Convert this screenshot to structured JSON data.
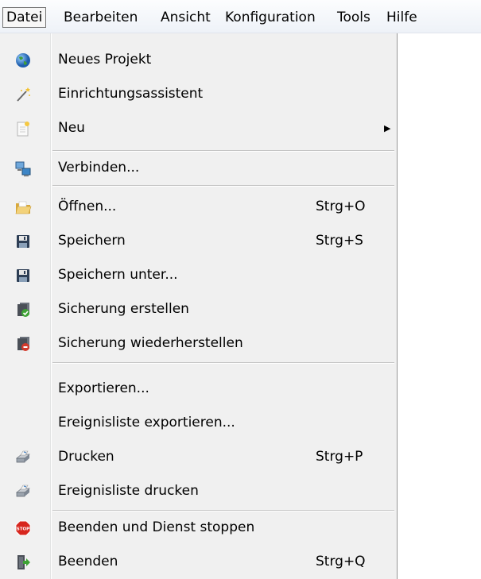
{
  "menubar": {
    "items": [
      {
        "label": "Datei",
        "active": true
      },
      {
        "label": "Bearbeiten"
      },
      {
        "label": "Ansicht"
      },
      {
        "label": "Konfiguration"
      },
      {
        "label": "Tools"
      },
      {
        "label": "Hilfe"
      }
    ]
  },
  "menu": {
    "items": [
      {
        "label": "Neues Projekt",
        "icon": "globe-icon"
      },
      {
        "label": "Einrichtungsassistent",
        "icon": "magic-wand-icon"
      },
      {
        "label": "Neu",
        "icon": "new-document-icon",
        "submenu_arrow": "▶"
      },
      {
        "label": "Verbinden...",
        "icon": "network-connect-icon"
      },
      {
        "label": "Öffnen...",
        "icon": "open-folder-icon",
        "shortcut": "Strg+O"
      },
      {
        "label": "Speichern",
        "icon": "floppy-disk-icon",
        "shortcut": "Strg+S"
      },
      {
        "label": "Speichern unter...",
        "icon": "floppy-disk-icon"
      },
      {
        "label": "Sicherung erstellen",
        "icon": "backup-create-icon"
      },
      {
        "label": "Sicherung wiederherstellen",
        "icon": "backup-restore-icon"
      },
      {
        "label": "Exportieren..."
      },
      {
        "label": "Ereignisliste exportieren..."
      },
      {
        "label": "Drucken",
        "icon": "printer-icon",
        "shortcut": "Strg+P"
      },
      {
        "label": "Ereignisliste drucken",
        "icon": "printer-icon"
      },
      {
        "label": "Beenden und Dienst stoppen",
        "icon": "stop-sign-icon"
      },
      {
        "label": "Beenden",
        "icon": "exit-icon",
        "shortcut": "Strg+Q"
      }
    ]
  },
  "colors": {
    "globe": "#2f7fd4",
    "folder": "#e9c35a",
    "floppy": "#2d3e55",
    "backup_green": "#3ea335",
    "backup_red": "#d33a2c",
    "stop_red": "#d7261e"
  }
}
